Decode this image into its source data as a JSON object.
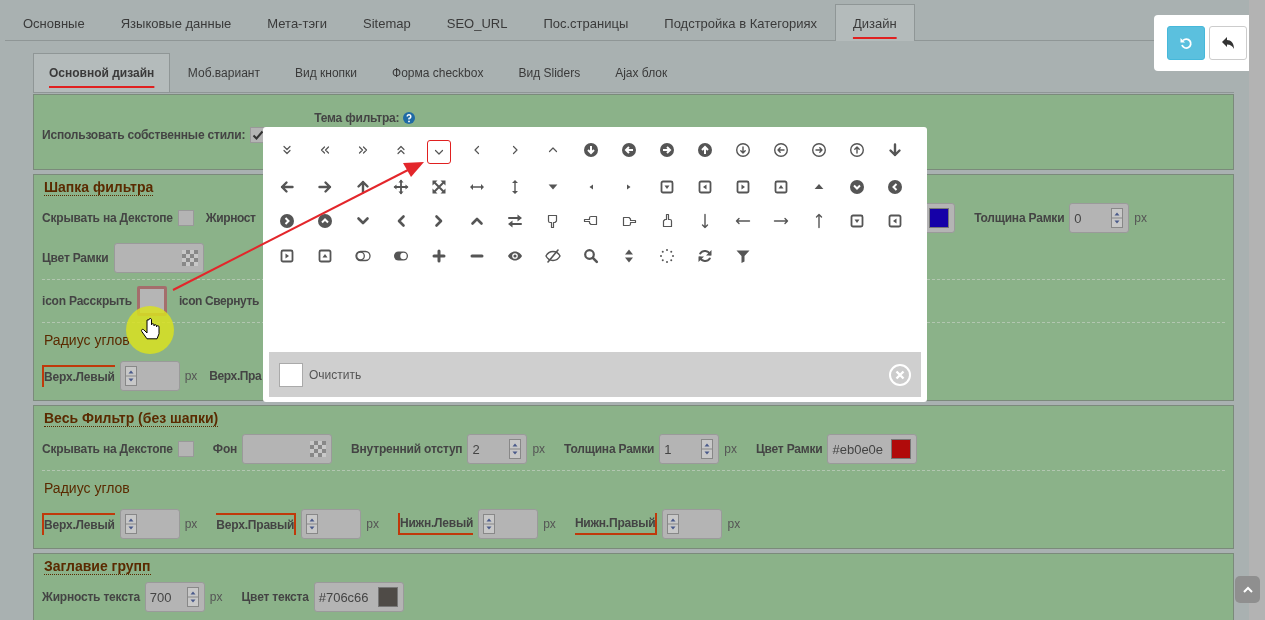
{
  "tabs": [
    {
      "label": "Основные",
      "selected": false
    },
    {
      "label": "Языковые данные",
      "selected": false
    },
    {
      "label": "Мета-тэги",
      "selected": false
    },
    {
      "label": "Sitemap",
      "selected": false
    },
    {
      "label": "SEO_URL",
      "selected": false
    },
    {
      "label": "Пос.страницы",
      "selected": false
    },
    {
      "label": "Подстройка в Категориях",
      "selected": false
    },
    {
      "label": "Дизайн",
      "selected": true
    }
  ],
  "subtabs": [
    {
      "label": "Основной дизайн",
      "selected": true
    },
    {
      "label": "Моб.вариант",
      "selected": false
    },
    {
      "label": "Вид кнопки",
      "selected": false
    },
    {
      "label": "Форма checkbox",
      "selected": false
    },
    {
      "label": "Вид Sliders",
      "selected": false
    },
    {
      "label": "Ajax блок",
      "selected": false
    }
  ],
  "sections": [
    {
      "rows": [
        {
          "kind": "fields",
          "left": [
            {
              "kind": "checkbox",
              "label": "Использовать собственные стили:",
              "checked": true
            },
            {
              "kind": "select",
              "label": "Тема фильтра:"
            }
          ]
        }
      ]
    },
    {
      "title": "Шапка фильтра",
      "rows": [
        {
          "kind": "fields",
          "left": [
            {
              "kind": "checkbox",
              "label": "Скрывать на Декстопе",
              "checked": false
            },
            {
              "kind": "label",
              "label": "Жирност"
            }
          ],
          "right": [
            {
              "kind": "color",
              "color": "#1500a8"
            },
            {
              "kind": "number",
              "label": "Толщина Рамки",
              "value": "0",
              "unit": "px"
            }
          ]
        },
        {
          "kind": "fields",
          "left": [
            {
              "kind": "color",
              "label": "Цвет Рамки"
            }
          ]
        },
        {
          "kind": "divider"
        },
        {
          "kind": "fields",
          "left": [
            {
              "kind": "icon",
              "label": "icon Расскрыть"
            },
            {
              "kind": "label",
              "label": "icon Свернуть"
            }
          ]
        },
        {
          "kind": "divider"
        },
        {
          "kind": "heading",
          "label": "Радиус углов"
        },
        {
          "kind": "fields",
          "left": [
            {
              "kind": "topleft",
              "label": "Верх.Левый",
              "unit": "px"
            },
            {
              "kind": "label",
              "label": "Верх.Пра"
            }
          ]
        }
      ]
    },
    {
      "title": "Весь Фильтр (без шапки)",
      "rows": [
        {
          "kind": "fields",
          "left": [
            {
              "kind": "checkbox",
              "label": "Скрывать на Декстопе",
              "checked": false
            },
            {
              "kind": "color",
              "label": "Фон"
            },
            {
              "kind": "number",
              "label": "Внутренний отступ",
              "value": "2",
              "unit": "px"
            },
            {
              "kind": "number",
              "label": "Толщина Рамки",
              "value": "1",
              "unit": "px"
            },
            {
              "kind": "color",
              "label": "Цвет Рамки",
              "value": "#eb0e0e",
              "color": "#b00b0b"
            }
          ]
        },
        {
          "kind": "divider"
        },
        {
          "kind": "heading",
          "label": "Радиус углов"
        },
        {
          "kind": "fields",
          "left": [
            {
              "kind": "topleft",
              "label": "Верх.Левый",
              "unit": "px"
            },
            {
              "kind": "topright",
              "label": "Верх.Правый",
              "unit": "px"
            },
            {
              "kind": "bottomleft",
              "label": "Нижн.Левый",
              "unit": "px"
            },
            {
              "kind": "bottomright",
              "label": "Нижн.Правый",
              "unit": "px"
            }
          ]
        }
      ]
    },
    {
      "title": "Заглавие групп",
      "rows": [
        {
          "kind": "fields",
          "left": [
            {
              "kind": "number",
              "label": "Жирность текста",
              "value": "700",
              "unit": "px"
            },
            {
              "kind": "color",
              "label": "Цвет текста",
              "value": "#706c66",
              "color": "#4f4b47"
            }
          ]
        }
      ]
    }
  ],
  "icon_picker": {
    "clear_label": "Очистить",
    "icons": [
      {
        "selected": false
      },
      {
        "selected": false
      },
      {
        "selected": false
      },
      {
        "selected": false
      },
      {
        "selected": true
      },
      {
        "selected": false
      },
      {
        "selected": false
      },
      {
        "selected": false
      },
      {
        "selected": false
      },
      {
        "selected": false
      },
      {
        "selected": false
      },
      {
        "selected": false
      },
      {
        "selected": false
      },
      {
        "selected": false
      },
      {
        "selected": false
      },
      {
        "selected": false
      },
      {
        "selected": false
      },
      {
        "selected": false
      },
      {
        "selected": false
      },
      {
        "selected": false
      },
      {
        "selected": false
      },
      {
        "selected": false
      },
      {
        "selected": false
      },
      {
        "selected": false
      },
      {
        "selected": false
      },
      {
        "selected": false
      },
      {
        "selected": false
      },
      {
        "selected": false
      },
      {
        "selected": false
      },
      {
        "selected": false
      },
      {
        "selected": false
      },
      {
        "selected": false
      },
      {
        "selected": false
      },
      {
        "selected": false
      },
      {
        "selected": false
      },
      {
        "selected": false
      },
      {
        "selected": false
      },
      {
        "selected": false
      },
      {
        "selected": false
      },
      {
        "selected": false
      },
      {
        "selected": false
      },
      {
        "selected": false
      },
      {
        "selected": false
      },
      {
        "selected": false
      },
      {
        "selected": false
      },
      {
        "selected": false
      },
      {
        "selected": false
      },
      {
        "selected": false
      },
      {
        "selected": false
      },
      {
        "selected": false
      },
      {
        "selected": false
      },
      {
        "selected": false
      },
      {
        "selected": false
      },
      {
        "selected": false
      },
      {
        "selected": false
      },
      {
        "selected": false
      },
      {
        "selected": false
      },
      {
        "selected": false
      },
      {
        "selected": false
      },
      {
        "selected": false
      },
      {
        "selected": false
      },
      {
        "selected": false
      },
      {
        "selected": false
      },
      {
        "selected": false
      }
    ]
  }
}
